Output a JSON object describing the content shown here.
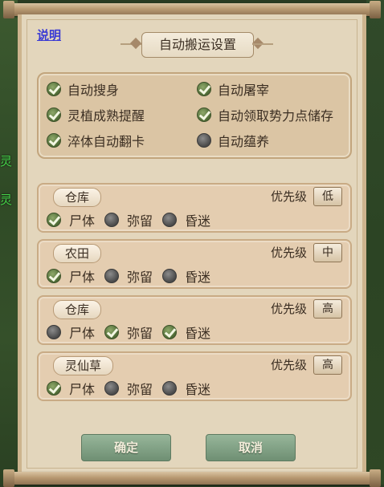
{
  "help_link": "说明",
  "title": "自动搬运设置",
  "background_text": [
    "灵",
    "灵"
  ],
  "options": [
    {
      "label": "自动搜身",
      "checked": true
    },
    {
      "label": "自动屠宰",
      "checked": true
    },
    {
      "label": "灵植成熟提醒",
      "checked": true
    },
    {
      "label": "自动领取势力点储存",
      "checked": true
    },
    {
      "label": "淬体自动翻卡",
      "checked": true
    },
    {
      "label": "自动蕴养",
      "checked": false
    }
  ],
  "priority_label": "优先级",
  "rules": [
    {
      "location": "仓库",
      "priority": "低",
      "targets": [
        {
          "label": "尸体",
          "checked": true
        },
        {
          "label": "弥留",
          "checked": false
        },
        {
          "label": "昏迷",
          "checked": false
        }
      ]
    },
    {
      "location": "农田",
      "priority": "中",
      "targets": [
        {
          "label": "尸体",
          "checked": true
        },
        {
          "label": "弥留",
          "checked": false
        },
        {
          "label": "昏迷",
          "checked": false
        }
      ]
    },
    {
      "location": "仓库",
      "priority": "高",
      "targets": [
        {
          "label": "尸体",
          "checked": false
        },
        {
          "label": "弥留",
          "checked": true
        },
        {
          "label": "昏迷",
          "checked": true
        }
      ]
    },
    {
      "location": "灵仙草",
      "priority": "高",
      "targets": [
        {
          "label": "尸体",
          "checked": true
        },
        {
          "label": "弥留",
          "checked": false
        },
        {
          "label": "昏迷",
          "checked": false
        }
      ]
    }
  ],
  "confirm_label": "确定",
  "cancel_label": "取消"
}
